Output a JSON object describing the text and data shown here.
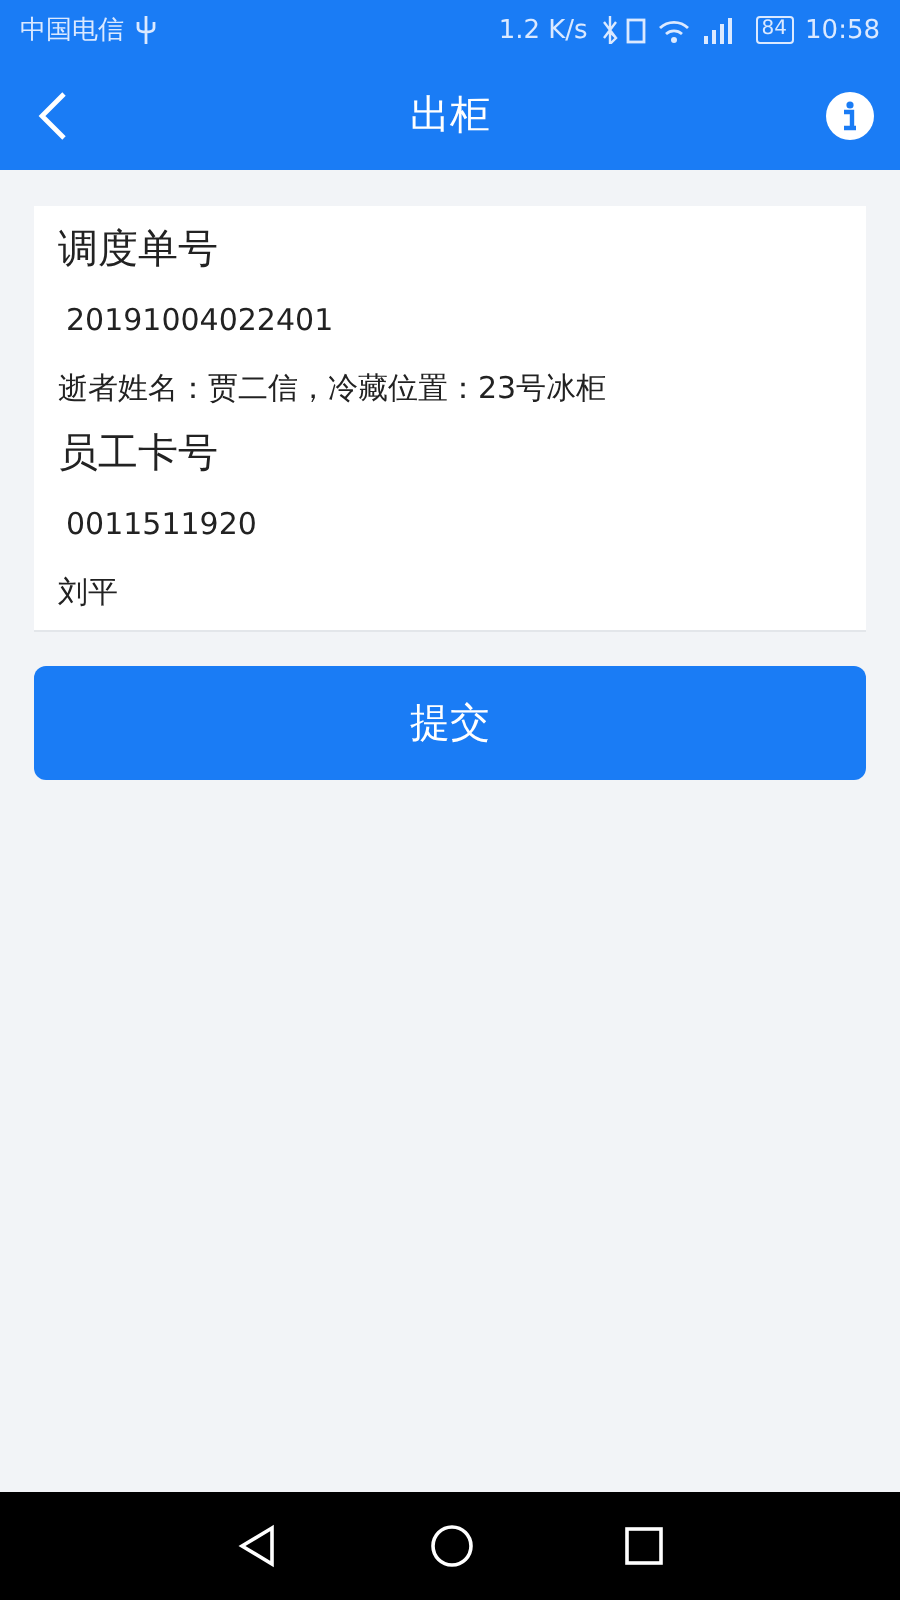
{
  "status_bar": {
    "carrier": "中国电信",
    "speed": "1.2 K/s",
    "battery": "84",
    "time": "10:58"
  },
  "app_bar": {
    "title": "出柜"
  },
  "fields": [
    {
      "label": "调度单号",
      "value": "20191004022401",
      "note": "逝者姓名：贾二信，冷藏位置：23号冰柜"
    },
    {
      "label": "员工卡号",
      "value": "0011511920",
      "note": "刘平"
    }
  ],
  "submit_button": "提交"
}
